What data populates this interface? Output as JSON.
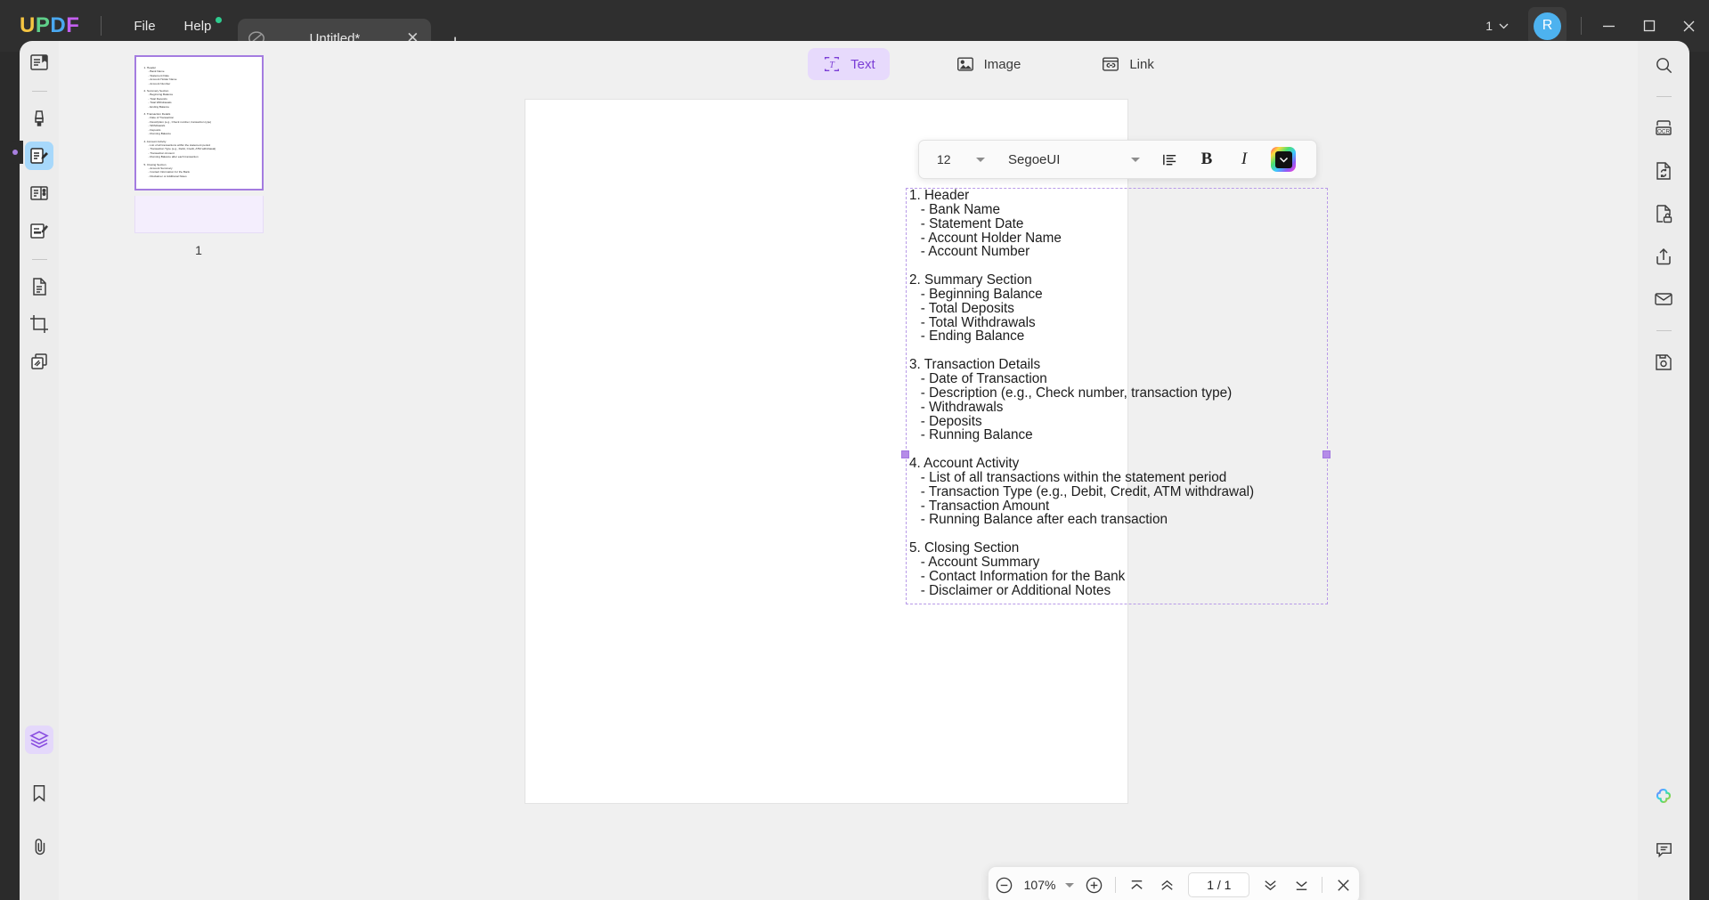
{
  "app": {
    "name": "UPDF",
    "logo_letters": [
      "U",
      "P",
      "D",
      "F"
    ]
  },
  "titlebar": {
    "menus": [
      {
        "label": "File",
        "has_dot": false
      },
      {
        "label": "Help",
        "has_dot": true
      }
    ],
    "tab": {
      "title": "Untitled*",
      "icon": "document-slash-icon",
      "close_label": "✕"
    },
    "new_tab_label": "+",
    "window_count": "1",
    "window_count_caret": "⌄",
    "avatar_letter": "R",
    "minimize_label": "minimize-icon",
    "maximize_label": "maximize-icon",
    "close_label": "close-icon"
  },
  "left_rail": {
    "items": [
      {
        "name": "reader-mode",
        "icon": "book-open-icon",
        "selected": false
      },
      {
        "name": "separator-1",
        "icon": "separator",
        "selected": false
      },
      {
        "name": "comment-tool",
        "icon": "highlighter-pen-icon",
        "selected": false
      },
      {
        "name": "edit-pdf",
        "icon": "edit-document-icon",
        "selected": true
      },
      {
        "name": "organize-pages",
        "icon": "page-organize-icon",
        "selected": false
      },
      {
        "name": "form-tool",
        "icon": "form-edit-icon",
        "selected": false
      },
      {
        "name": "separator-2",
        "icon": "separator",
        "selected": false
      },
      {
        "name": "page-tool",
        "icon": "document-lines-icon",
        "selected": false
      },
      {
        "name": "crop-tool",
        "icon": "crop-icon",
        "selected": false
      },
      {
        "name": "batch-tool",
        "icon": "stacked-pages-icon",
        "selected": false
      }
    ],
    "bottom_items": [
      {
        "name": "layers-panel",
        "icon": "layers-icon",
        "selected": true
      },
      {
        "name": "bookmarks-panel",
        "icon": "bookmark-icon",
        "selected": false
      },
      {
        "name": "attachments-panel",
        "icon": "paperclip-icon",
        "selected": false
      }
    ]
  },
  "thumbnails": {
    "page_label": "1",
    "selected_page": 1,
    "selection_color": "#a47ce0",
    "mini_lines": [
      {
        "text": "1. Header",
        "indent": false
      },
      {
        "text": "- Bank Name",
        "indent": true
      },
      {
        "text": "- Statement Date",
        "indent": true
      },
      {
        "text": "- Account Holder Name",
        "indent": true
      },
      {
        "text": "- Account Number",
        "indent": true
      },
      {
        "text": "",
        "indent": false
      },
      {
        "text": "2. Summary Section",
        "indent": false
      },
      {
        "text": "- Beginning Balance",
        "indent": true
      },
      {
        "text": "- Total Deposits",
        "indent": true
      },
      {
        "text": "- Total Withdrawals",
        "indent": true
      },
      {
        "text": "- Ending Balance",
        "indent": true
      },
      {
        "text": "",
        "indent": false
      },
      {
        "text": "3. Transaction Details",
        "indent": false
      },
      {
        "text": "- Date of Transaction",
        "indent": true
      },
      {
        "text": "- Description (e.g., Check number, transaction type)",
        "indent": true
      },
      {
        "text": "- Withdrawals",
        "indent": true
      },
      {
        "text": "- Deposits",
        "indent": true
      },
      {
        "text": "- Running Balance",
        "indent": true
      },
      {
        "text": "",
        "indent": false
      },
      {
        "text": "4. Account Activity",
        "indent": false
      },
      {
        "text": "- List of all transactions within the statement period",
        "indent": true
      },
      {
        "text": "- Transaction Type (e.g., Debit, Credit, ATM withdrawal)",
        "indent": true
      },
      {
        "text": "- Transaction Amount",
        "indent": true
      },
      {
        "text": "- Running Balance after each transaction",
        "indent": true
      },
      {
        "text": "",
        "indent": false
      },
      {
        "text": "5. Closing Section",
        "indent": false
      },
      {
        "text": "- Account Summary",
        "indent": true
      },
      {
        "text": "- Contact Information for the Bank",
        "indent": true
      },
      {
        "text": "- Disclaimer or Additional Notes",
        "indent": true
      }
    ]
  },
  "top_tools": [
    {
      "label": "Text",
      "icon": "text-tool-icon",
      "active": true
    },
    {
      "label": "Image",
      "icon": "image-tool-icon",
      "active": false
    },
    {
      "label": "Link",
      "icon": "link-tool-icon",
      "active": false
    }
  ],
  "format_toolbar": {
    "font_size": "12",
    "font_family": "SegoeUI",
    "align_icon": "align-left-icon",
    "bold_label": "B",
    "italic_label": "I",
    "color_swatch": "#111111",
    "color_picker_icon": "chevron-down-icon"
  },
  "document": {
    "lines": [
      "1. Header",
      "   - Bank Name",
      "   - Statement Date",
      "   - Account Holder Name",
      "   - Account Number",
      "",
      "2. Summary Section",
      "   - Beginning Balance",
      "   - Total Deposits",
      "   - Total Withdrawals",
      "   - Ending Balance",
      "",
      "3. Transaction Details",
      "   - Date of Transaction",
      "   - Description (e.g., Check number, transaction type)",
      "   - Withdrawals",
      "   - Deposits",
      "   - Running Balance",
      "",
      "4. Account Activity",
      "   - List of all transactions within the statement period",
      "   - Transaction Type (e.g., Debit, Credit, ATM withdrawal)",
      "   - Transaction Amount",
      "   - Running Balance after each transaction",
      "",
      "5. Closing Section",
      "   - Account Summary",
      "   - Contact Information for the Bank",
      "   - Disclaimer or Additional Notes"
    ]
  },
  "pager": {
    "zoom_out_icon": "minus-circle-icon",
    "zoom_level": "107%",
    "zoom_caret": "caret-down-icon",
    "zoom_in_icon": "plus-circle-icon",
    "first_page_icon": "first-page-icon",
    "prev_page_icon": "prev-page-icon",
    "page_value": "1 / 1",
    "next_page_icon": "next-page-icon",
    "last_page_icon": "last-page-icon",
    "close_icon": "close-icon"
  },
  "right_rail": {
    "items": [
      {
        "name": "search",
        "icon": "search-icon"
      },
      {
        "name": "separator-1",
        "icon": "separator"
      },
      {
        "name": "ocr",
        "icon": "ocr-icon"
      },
      {
        "name": "convert",
        "icon": "convert-document-icon"
      },
      {
        "name": "protect",
        "icon": "document-lock-icon"
      },
      {
        "name": "share",
        "icon": "share-upload-icon"
      },
      {
        "name": "email",
        "icon": "envelope-icon"
      },
      {
        "name": "separator-2",
        "icon": "separator"
      },
      {
        "name": "save",
        "icon": "floppy-save-icon"
      }
    ],
    "bottom_items": [
      {
        "name": "ai-assistant",
        "icon": "ai-clover-icon"
      },
      {
        "name": "feedback",
        "icon": "comment-bubble-icon"
      }
    ]
  },
  "colors": {
    "accent_purple": "#7c3fd6",
    "accent_purple_bg": "#e7dafc",
    "selection_blue": "#a7d8fb",
    "avatar_blue": "#4db2ef",
    "titlebar": "#2f2f2f",
    "panel": "#ececec",
    "notification_dot": "#2ecc8f"
  }
}
